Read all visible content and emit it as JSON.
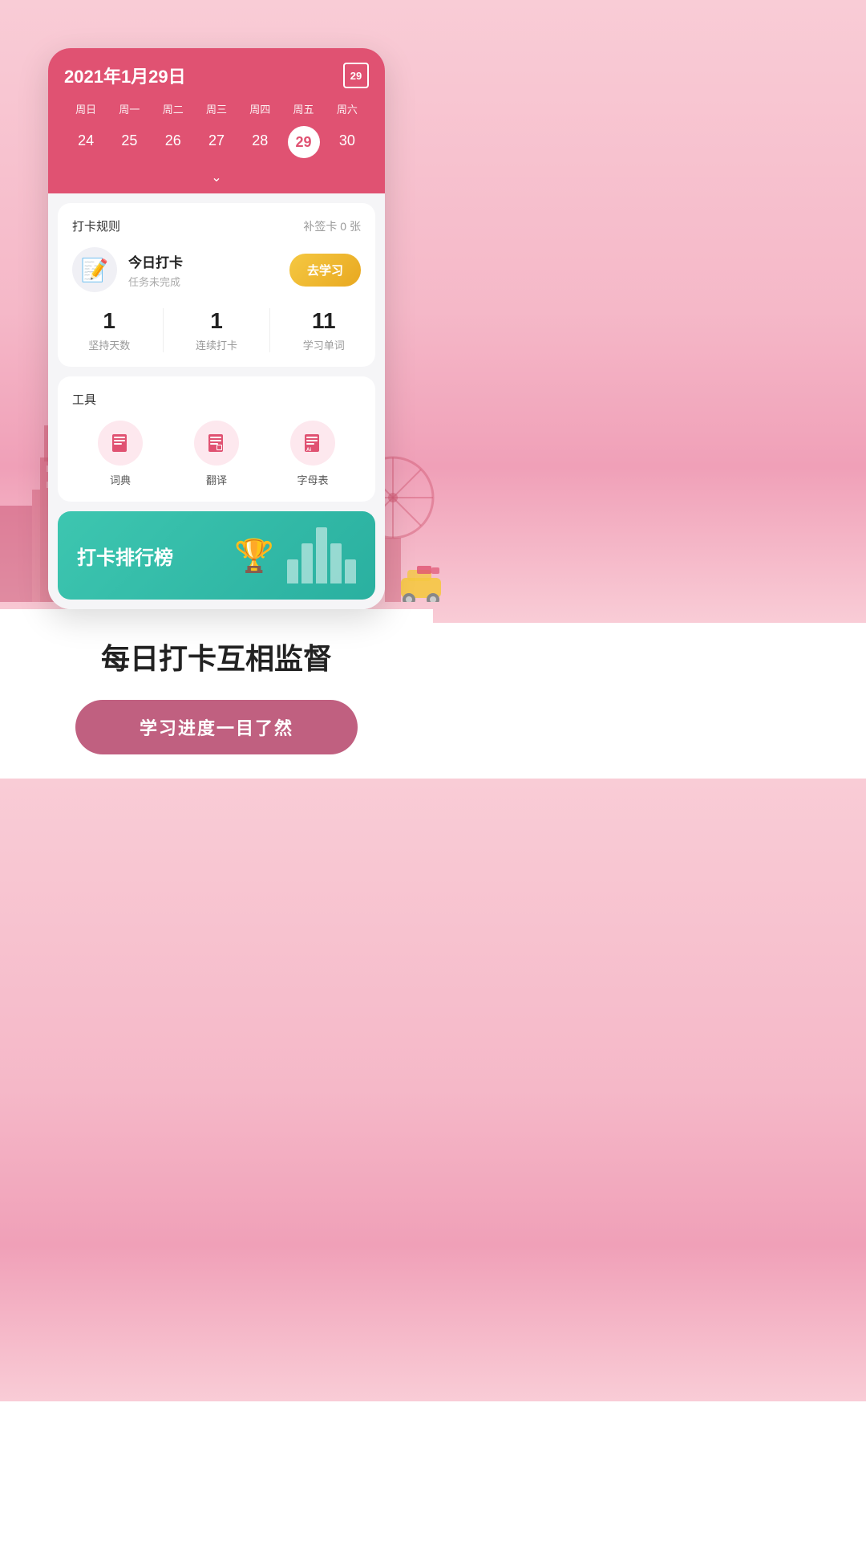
{
  "app": {
    "background_top": "#f9ccd6",
    "background_bottom": "#ffffff"
  },
  "calendar": {
    "title": "2021年1月29日",
    "icon_label": "29",
    "weekdays": [
      "周日",
      "周一",
      "周二",
      "周三",
      "周四",
      "周五",
      "周六"
    ],
    "dates": [
      "24",
      "25",
      "26",
      "27",
      "28",
      "29",
      "30"
    ],
    "selected_date": "29",
    "chevron": "∨"
  },
  "checkin_card": {
    "title": "打卡规则",
    "supplement": "补签卡 0 张",
    "task_name": "今日打卡",
    "task_status": "任务未完成",
    "go_study_label": "去学习",
    "stats": [
      {
        "value": "1",
        "label": "坚持天数"
      },
      {
        "value": "1",
        "label": "连续打卡"
      },
      {
        "value": "11",
        "label": "学习单词"
      }
    ]
  },
  "tools_card": {
    "title": "工具",
    "tools": [
      {
        "name": "dict-tool",
        "icon": "📖",
        "label": "词典"
      },
      {
        "name": "translate-tool",
        "icon": "📋",
        "label": "翻译"
      },
      {
        "name": "alphabet-tool",
        "icon": "📄",
        "label": "字母表"
      }
    ]
  },
  "ranking_banner": {
    "text_highlighted": "打卡",
    "text_normal": "排行榜",
    "trophy_icon": "🏆",
    "bars": [
      30,
      50,
      70,
      50,
      30
    ]
  },
  "bottom": {
    "tagline": "每日打卡互相监督",
    "cta_label": "学习进度一目了然"
  }
}
